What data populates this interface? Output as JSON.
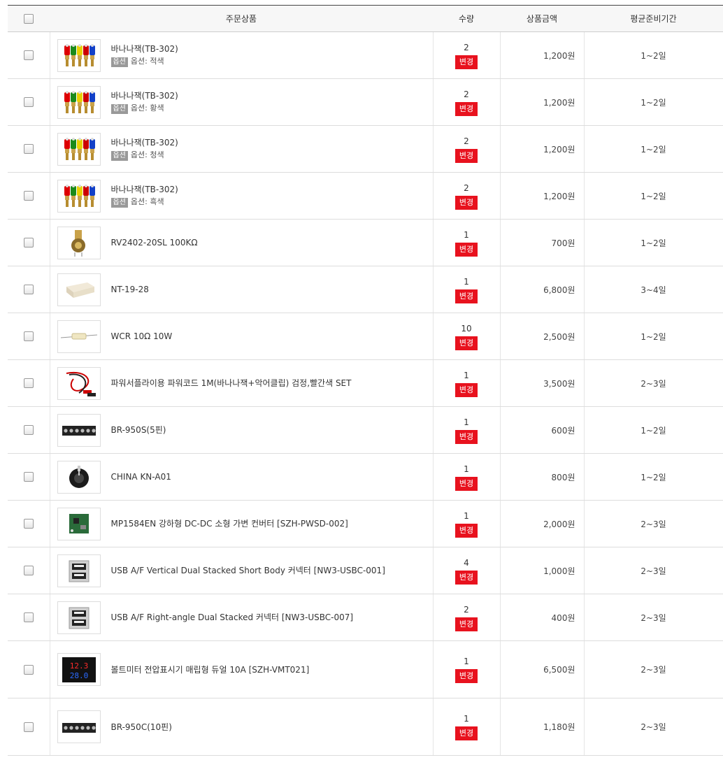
{
  "header": {
    "product_col": "주문상품",
    "qty_col": "수량",
    "price_col": "상품금액",
    "prep_col": "평균준비기간"
  },
  "change_label": "변경",
  "option_badge": "옵션",
  "colors": {
    "change_button": "#e8121e",
    "option_badge": "#999999"
  },
  "items": [
    {
      "name": "바나나잭(TB-302)",
      "option": "옵션: 적색",
      "qty": "2",
      "price": "1,200원",
      "prep": "1~2일",
      "thumb": "banana-jack-icon"
    },
    {
      "name": "바나나잭(TB-302)",
      "option": "옵션: 황색",
      "qty": "2",
      "price": "1,200원",
      "prep": "1~2일",
      "thumb": "banana-jack-icon"
    },
    {
      "name": "바나나잭(TB-302)",
      "option": "옵션: 청색",
      "qty": "2",
      "price": "1,200원",
      "prep": "1~2일",
      "thumb": "banana-jack-icon"
    },
    {
      "name": "바나나잭(TB-302)",
      "option": "옵션: 흑색",
      "qty": "2",
      "price": "1,200원",
      "prep": "1~2일",
      "thumb": "banana-jack-icon"
    },
    {
      "name": "RV2402-20SL 100KΩ",
      "qty": "1",
      "price": "700원",
      "prep": "1~2일",
      "thumb": "potentiometer-icon"
    },
    {
      "name": "NT-19-28",
      "qty": "1",
      "price": "6,800원",
      "prep": "3~4일",
      "thumb": "enclosure-icon"
    },
    {
      "name": "WCR 10Ω 10W",
      "qty": "10",
      "price": "2,500원",
      "prep": "1~2일",
      "thumb": "resistor-icon"
    },
    {
      "name": "파워서플라이용 파워코드 1M(바나나잭+악어클립) 검정,빨간색 SET",
      "qty": "1",
      "price": "3,500원",
      "prep": "2~3일",
      "thumb": "power-cord-icon"
    },
    {
      "name": "BR-950S(5핀)",
      "qty": "1",
      "price": "600원",
      "prep": "1~2일",
      "thumb": "terminal-block-icon"
    },
    {
      "name": "CHINA KN-A01",
      "qty": "1",
      "price": "800원",
      "prep": "1~2일",
      "thumb": "knob-icon"
    },
    {
      "name": "MP1584EN 강하형 DC-DC 소형 가변 컨버터 [SZH-PWSD-002]",
      "qty": "1",
      "price": "2,000원",
      "prep": "2~3일",
      "thumb": "pcb-module-icon"
    },
    {
      "name": "USB A/F Vertical Dual Stacked Short Body 커넥터 [NW3-USBC-001]",
      "qty": "4",
      "price": "1,000원",
      "prep": "2~3일",
      "thumb": "usb-connector-icon"
    },
    {
      "name": "USB A/F Right-angle Dual Stacked 커넥터 [NW3-USBC-007]",
      "qty": "2",
      "price": "400원",
      "prep": "2~3일",
      "thumb": "usb-connector-icon"
    },
    {
      "name": "볼트미터 전압표시기 매립형 듀얼 10A [SZH-VMT021]",
      "qty": "1",
      "price": "6,500원",
      "prep": "2~3일",
      "thumb": "voltmeter-icon",
      "meter_top": "12.3",
      "meter_bottom": "28.0"
    },
    {
      "name": "BR-950C(10핀)",
      "qty": "1",
      "price": "1,180원",
      "prep": "2~3일",
      "thumb": "terminal-block-icon"
    }
  ]
}
